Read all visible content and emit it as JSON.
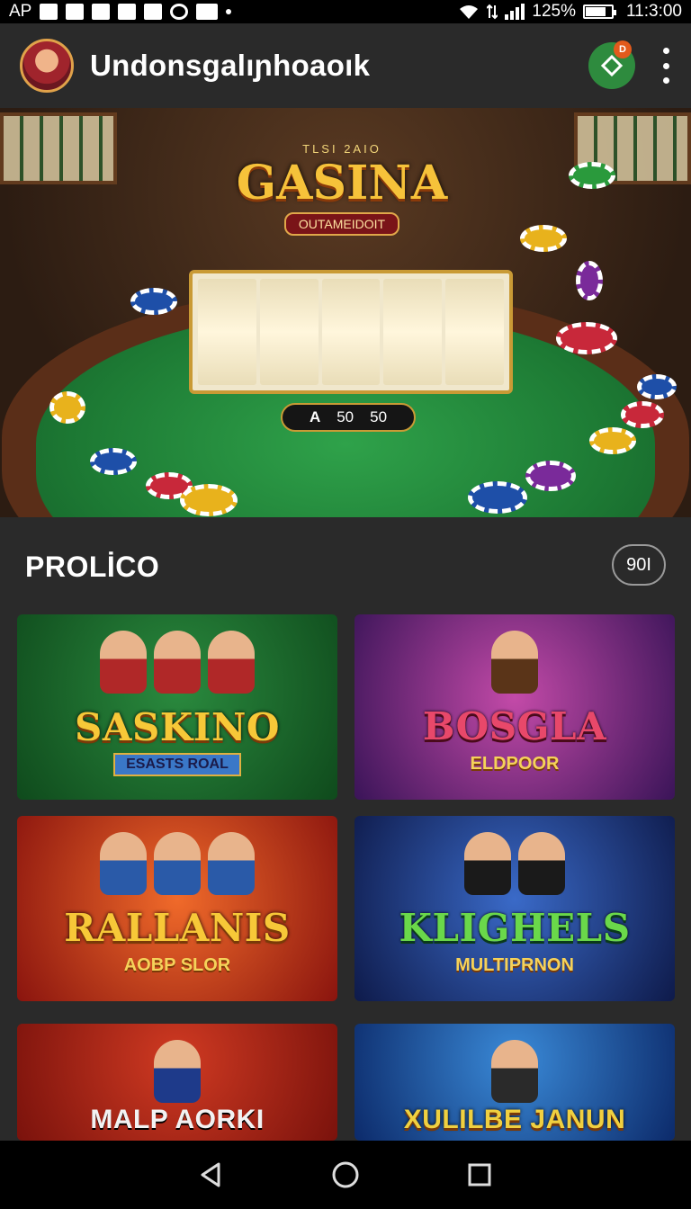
{
  "status_bar": {
    "left_text": "AP",
    "battery_percent": "125%",
    "battery_level": 0.8,
    "time": "11:3:00"
  },
  "app_bar": {
    "title": "Undonsgalıɲhoaoık",
    "badge_text": "D"
  },
  "hero": {
    "logo_top": "TLSI 2AIO",
    "logo_main": "GASINA",
    "logo_sub": "OUTAMEIDOIT",
    "bet_label": "A",
    "bet_value_1": "50",
    "bet_value_2": "50"
  },
  "section": {
    "title": "PROLİCO",
    "count": "90I"
  },
  "games": [
    {
      "title": "SASKINO",
      "subtitle": "ESASTS ROAL"
    },
    {
      "title": "BOSGLA",
      "subtitle": "ELDPOOR"
    },
    {
      "title": "RALLANIS",
      "subtitle": "AOBP SLOR"
    },
    {
      "title": "KLIGHELS",
      "subtitle": "MULTIPRNON"
    },
    {
      "title": "MALP AORKI",
      "subtitle": ""
    },
    {
      "title": "XULILBE JANUN",
      "subtitle": ""
    }
  ],
  "colors": {
    "background": "#2a2a2a",
    "accent_green": "#2e8b3e",
    "badge_orange": "#e25a1c",
    "gold": "#f6c23a"
  },
  "icons": {
    "gift": "gift-diamond-icon",
    "more": "more-vertical-icon",
    "back": "back-triangle-icon",
    "home": "home-circle-icon",
    "recents": "recents-square-icon"
  }
}
